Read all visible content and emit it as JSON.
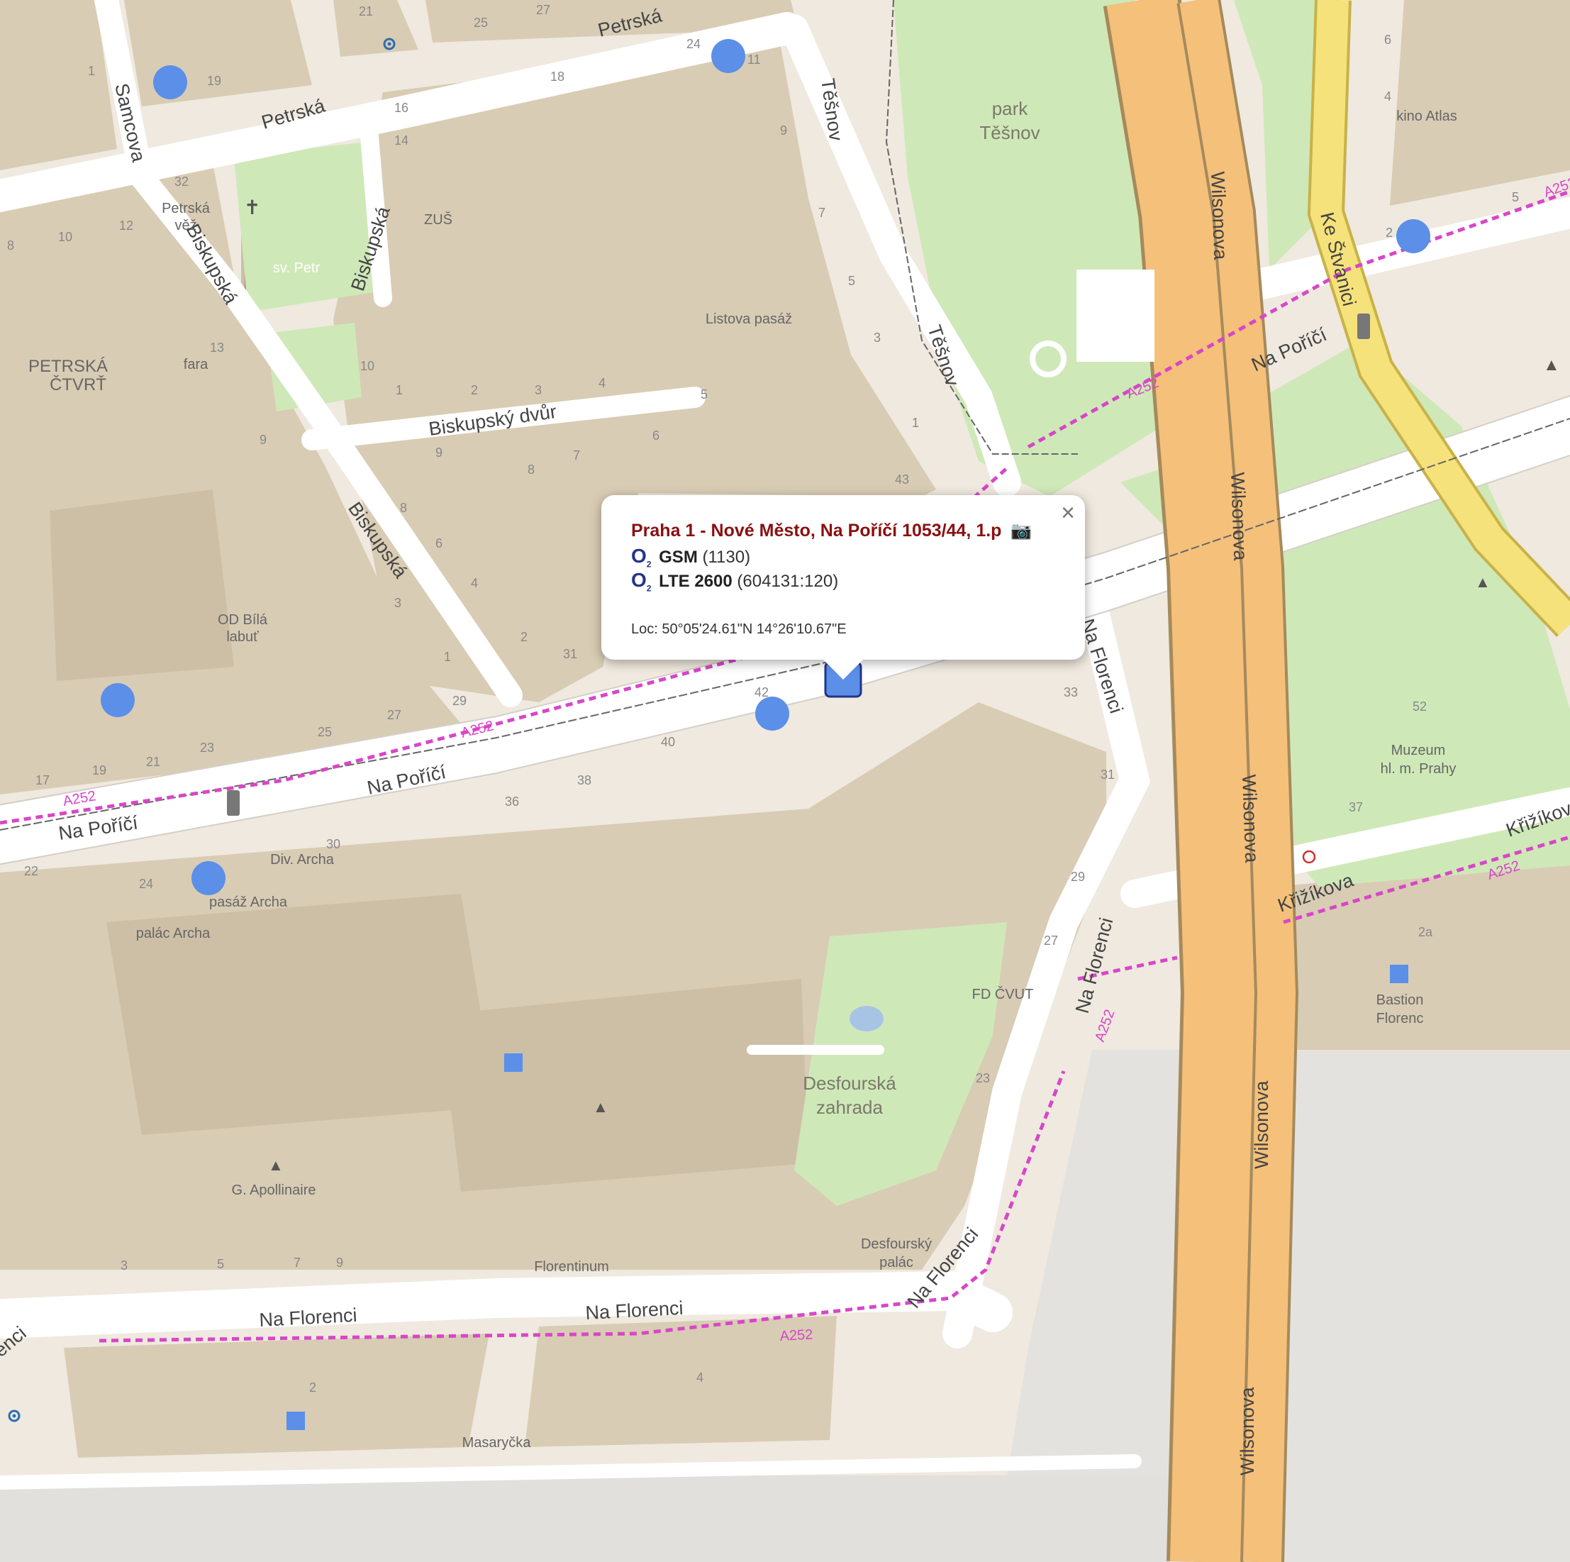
{
  "popup": {
    "title": "Praha 1 - Nové Město, Na Poříčí 1053/44, 1.p",
    "camera_icon": "📷",
    "close_glyph": "×",
    "rows": [
      {
        "operator": "O",
        "operator_sub": "2",
        "tech": "GSM",
        "detail": "(1130)"
      },
      {
        "operator": "O",
        "operator_sub": "2",
        "tech": "LTE 2600",
        "detail": "(604131:120)"
      }
    ],
    "location": "Loc: 50°05'24.61\"N 14°26'10.67\"E"
  },
  "streets": {
    "petrska_1": "Petrská",
    "petrska_2": "Petrská",
    "samcova": "Samcova",
    "biskupska_1": "Biskupská",
    "biskupska_2": "Biskupská",
    "biskupska_3": "Biskupská",
    "biskupsky_dvur": "Biskupský dvůr",
    "tesnov_1": "Těšnov",
    "tesnov_2": "Těšnov",
    "na_porici_1": "Na Poříčí",
    "na_porici_2": "Na Poříčí",
    "na_porici_3": "Na Poříčí",
    "na_florenci_1": "Na Florenci",
    "na_florenci_2": "Na Florenci",
    "na_florenci_3": "Na Florenci",
    "na_florenci_4": "Na Florenci",
    "na_florenci_5": "Na Florenci",
    "wilsonova_1": "Wilsonova",
    "wilsonova_2": "Wilsonova",
    "wilsonova_3": "Wilsonova",
    "wilsonova_4": "Wilsonova",
    "wilsonova_5": "Wilsonova",
    "ke_stvanici": "Ke Štvanici",
    "krizikova": "Křižíkova",
    "krizikova_2": "Křižíkova",
    "renci": "renci",
    "a252_1": "A252",
    "a252_2": "A252",
    "a252_3": "A252",
    "a252_4": "A252",
    "a252_5": "A252",
    "a252_6": "A252",
    "a252_7": "A252"
  },
  "pois": {
    "park_tesnov": [
      "park",
      "Těšnov"
    ],
    "kino_atlas": "kino Atlas",
    "petrska_vez": [
      "Petrská",
      "věž"
    ],
    "sv_petr": "sv. Petr",
    "zus": "ZUŠ",
    "listova_pasaz": "Listova pasáž",
    "petrska_ctvrt": [
      "PETRSKÁ",
      "ČTVRŤ"
    ],
    "fara": "fara",
    "od_bila_labut": [
      "OD Bílá",
      "labuť"
    ],
    "div_archa": "Div. Archa",
    "pasaz_archa": "pasáž Archa",
    "palac_archa": "palác Archa",
    "muzeum": [
      "Muzeum",
      "hl. m. Prahy"
    ],
    "bastion": [
      "Bastion",
      "Florenc"
    ],
    "fd_cvut": "FD ČVUT",
    "desfourska_zahrada": [
      "Desfourská",
      "zahrada"
    ],
    "g_apollinaire": "G. Apollinaire",
    "desfoursky_palac": [
      "Desfourský",
      "palác"
    ],
    "florentinum": "Florentinum",
    "masaryka": "Masaryčka"
  },
  "house_numbers": [
    "21",
    "25",
    "27",
    "24",
    "11",
    "19",
    "1",
    "16",
    "18",
    "14",
    "9",
    "12",
    "32",
    "10",
    "8",
    "13",
    "5",
    "7",
    "3",
    "9",
    "10",
    "1",
    "2",
    "3",
    "4",
    "5",
    "6",
    "9",
    "8",
    "7",
    "8",
    "6",
    "4",
    "3",
    "2",
    "1",
    "31",
    "29",
    "27",
    "25",
    "23",
    "21",
    "19",
    "17",
    "42",
    "40",
    "38",
    "36",
    "33",
    "31",
    "29",
    "27",
    "23",
    "22",
    "24",
    "30",
    "2",
    "4",
    "3",
    "5",
    "7",
    "9",
    "43",
    "1",
    "6",
    "4",
    "2",
    "5",
    "52",
    "37",
    "2a"
  ],
  "colors": {
    "land": "#efe9df",
    "building": "#d9ccb4",
    "park": "#cfe8b8",
    "road": "#ffffff",
    "motorway": "#f5c07a",
    "trunk": "#f6e27a",
    "cycleway": "#d846c8",
    "marker_blue": "#5b8fe8",
    "popup_title": "#8a1010"
  }
}
